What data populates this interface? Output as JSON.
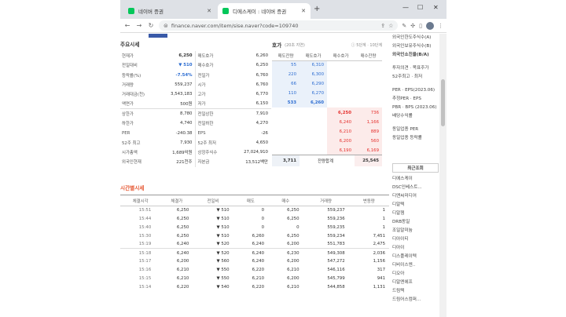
{
  "browser": {
    "tabs": [
      {
        "title": "네이버 증권"
      },
      {
        "title": "디에스케이 : 네이버 증권"
      }
    ],
    "url": "finance.naver.com/item/sise.naver?code=109740"
  },
  "market": {
    "title": "주요시세",
    "rows": [
      {
        "k1": "현재가",
        "v1": "6,250",
        "k2": "매도호가",
        "v2": "6,260"
      },
      {
        "k1": "전일대비",
        "v1": "▼ 510",
        "k2": "매수호가",
        "v2": "6,250"
      },
      {
        "k1": "등락률(%)",
        "v1": "-7.54%",
        "k2": "전일가",
        "v2": "6,760"
      },
      {
        "k1": "거래량",
        "v1": "559,237",
        "k2": "시가",
        "v2": "6,760"
      },
      {
        "k1": "거래대금(천)",
        "v1": "3,543,183",
        "k2": "고가",
        "v2": "6,770"
      },
      {
        "k1": "액면가",
        "v1": "500원",
        "k2": "저가",
        "v2": "6,150"
      },
      {
        "k1": "상한가",
        "v1": "8,780",
        "k2": "전일상한",
        "v2": "7,910"
      },
      {
        "k1": "하한가",
        "v1": "4,740",
        "k2": "전일하한",
        "v2": "4,270"
      },
      {
        "k1": "PER",
        "v1": "-240.38",
        "k2": "EPS",
        "v2": "-26"
      },
      {
        "k1": "52주 최고",
        "v1": "7,930",
        "k2": "52주 최저",
        "v2": "4,650"
      },
      {
        "k1": "시가총액",
        "v1": "1,689억원",
        "k2": "상장주식수",
        "v2": "27,024,910"
      },
      {
        "k1": "외국인현재",
        "v1": "221천주",
        "k2": "자본금",
        "v2": "13,512백만"
      }
    ]
  },
  "orderbook": {
    "title": "호가",
    "subtitle": "(20초 지연)",
    "links": "ⓘ 5단계 · 10단계",
    "headers": [
      "매도잔량",
      "매도호가",
      "매수호가",
      "매수잔량"
    ],
    "asks": [
      {
        "qty": "55",
        "price": "6,310"
      },
      {
        "qty": "220",
        "price": "6,300"
      },
      {
        "qty": "66",
        "price": "6,290"
      },
      {
        "qty": "110",
        "price": "6,270"
      },
      {
        "qty": "533",
        "price": "6,260"
      }
    ],
    "bids": [
      {
        "price": "6,250",
        "qty": "736"
      },
      {
        "price": "6,240",
        "qty": "1,166"
      },
      {
        "price": "6,210",
        "qty": "889"
      },
      {
        "price": "6,200",
        "qty": "560"
      },
      {
        "price": "6,190",
        "qty": "6,169"
      }
    ],
    "total_label": "잔량합계",
    "total_ask": "3,711",
    "total_bid": "25,545"
  },
  "time": {
    "title": "시간별시세",
    "headers": [
      "체결시각",
      "체결가",
      "전일비",
      "매도",
      "매수",
      "거래량",
      "변동량"
    ],
    "rows": [
      [
        "15:51",
        "6,250",
        "▼ 510",
        "0",
        "6,250",
        "559,237",
        "1"
      ],
      [
        "15:44",
        "6,250",
        "▼ 510",
        "0",
        "6,250",
        "559,236",
        "1"
      ],
      [
        "15:40",
        "6,250",
        "▼ 510",
        "0",
        "0",
        "559,235",
        "1"
      ],
      [
        "15:30",
        "6,250",
        "▼ 510",
        "6,260",
        "6,250",
        "559,234",
        "7,451"
      ],
      [
        "15:19",
        "6,240",
        "▼ 520",
        "6,240",
        "6,200",
        "551,783",
        "2,475"
      ],
      [
        "15:18",
        "6,240",
        "▼ 520",
        "6,240",
        "6,230",
        "549,308",
        "2,036"
      ],
      [
        "15:17",
        "6,200",
        "▼ 560",
        "6,240",
        "6,200",
        "547,272",
        "1,156"
      ],
      [
        "15:16",
        "6,210",
        "▼ 550",
        "6,220",
        "6,210",
        "546,116",
        "317"
      ],
      [
        "15:15",
        "6,210",
        "▼ 550",
        "6,210",
        "6,200",
        "545,799",
        "941"
      ],
      [
        "15:14",
        "6,220",
        "▼ 540",
        "6,220",
        "6,210",
        "544,858",
        "1,131"
      ]
    ]
  },
  "sidebar": {
    "top_items": [
      "외국인한도주식수(A)",
      "외국인보유주식수(B)",
      "외국인소진율(B/A)"
    ],
    "mid_items": [
      "투자의견 · 목표주가",
      "52주최고 · 최저"
    ],
    "ratio_items": [
      "PER · EPS(2023.06)",
      "추정PER · EPS",
      "PBR · BPS (2023.06)",
      "배당수익률"
    ],
    "peer_items": [
      "동일업종 PER",
      "동일업종 등락률"
    ],
    "recent_title": "최근조회",
    "recent_items": [
      "디에스케이",
      "DSC인베스트...",
      "디앤씨미디어",
      "디알텍",
      "디알젬",
      "DRB동일",
      "조일알미늄",
      "디아이티",
      "디아이",
      "디스플레이텍",
      "디비이스엔..",
      "디오아",
      "디알엔에프",
      "드림텍",
      "드림어스컴퍼..."
    ]
  }
}
